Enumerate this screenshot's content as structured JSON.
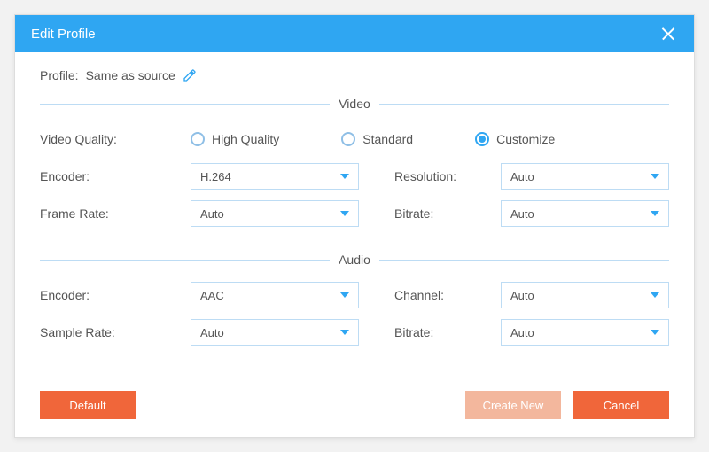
{
  "titlebar": {
    "title": "Edit Profile"
  },
  "profile": {
    "label": "Profile:",
    "value": "Same as source"
  },
  "sections": {
    "video_title": "Video",
    "audio_title": "Audio"
  },
  "video": {
    "quality_label": "Video Quality:",
    "radios": {
      "high": "High Quality",
      "standard": "Standard",
      "customize": "Customize"
    },
    "encoder_label": "Encoder:",
    "encoder_value": "H.264",
    "framerate_label": "Frame Rate:",
    "framerate_value": "Auto",
    "resolution_label": "Resolution:",
    "resolution_value": "Auto",
    "bitrate_label": "Bitrate:",
    "bitrate_value": "Auto"
  },
  "audio": {
    "encoder_label": "Encoder:",
    "encoder_value": "AAC",
    "samplerate_label": "Sample Rate:",
    "samplerate_value": "Auto",
    "channel_label": "Channel:",
    "channel_value": "Auto",
    "bitrate_label": "Bitrate:",
    "bitrate_value": "Auto"
  },
  "buttons": {
    "default": "Default",
    "create_new": "Create New",
    "cancel": "Cancel"
  }
}
